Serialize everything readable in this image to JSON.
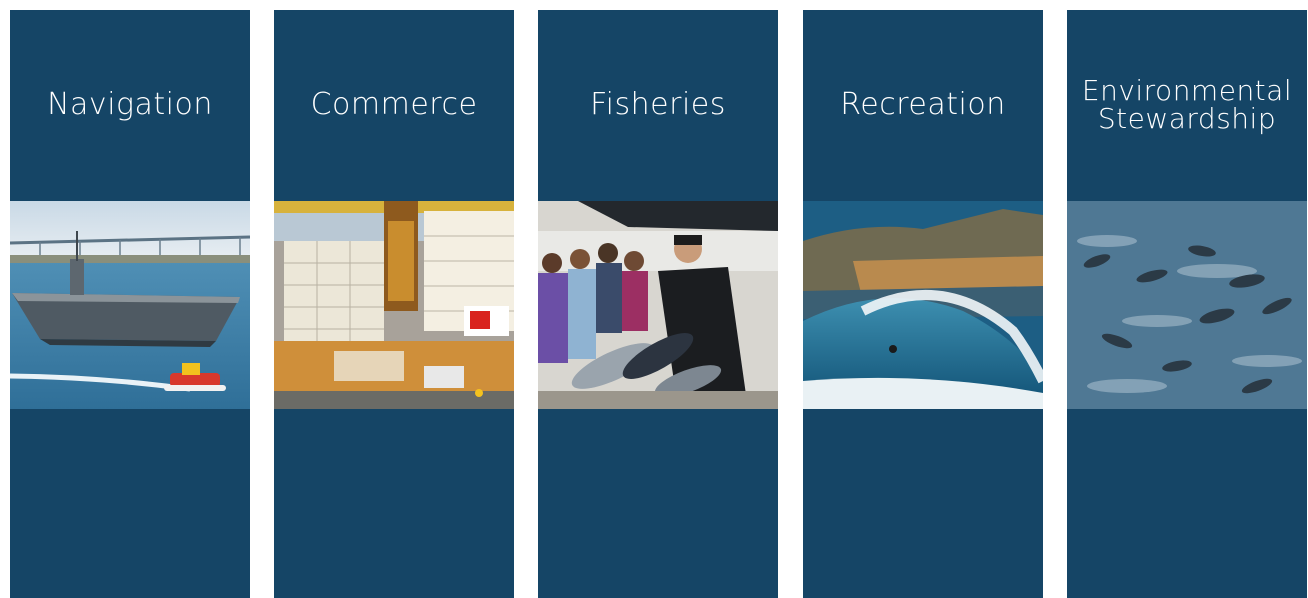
{
  "panels": [
    {
      "title": "Navigation",
      "image": "aircraft-carrier-tugboat-photo"
    },
    {
      "title": "Commerce",
      "image": "shipping-container-terminal-photo"
    },
    {
      "title": "Fisheries",
      "image": "fish-market-tuna-photo"
    },
    {
      "title": "Recreation",
      "image": "surfer-barrel-wave-photo"
    },
    {
      "title_line1": "Environmental",
      "title_line2": "Stewardship",
      "image": "dolphin-pod-photo"
    }
  ],
  "colors": {
    "panel_bg": "#154566",
    "text": "#ffffff"
  }
}
